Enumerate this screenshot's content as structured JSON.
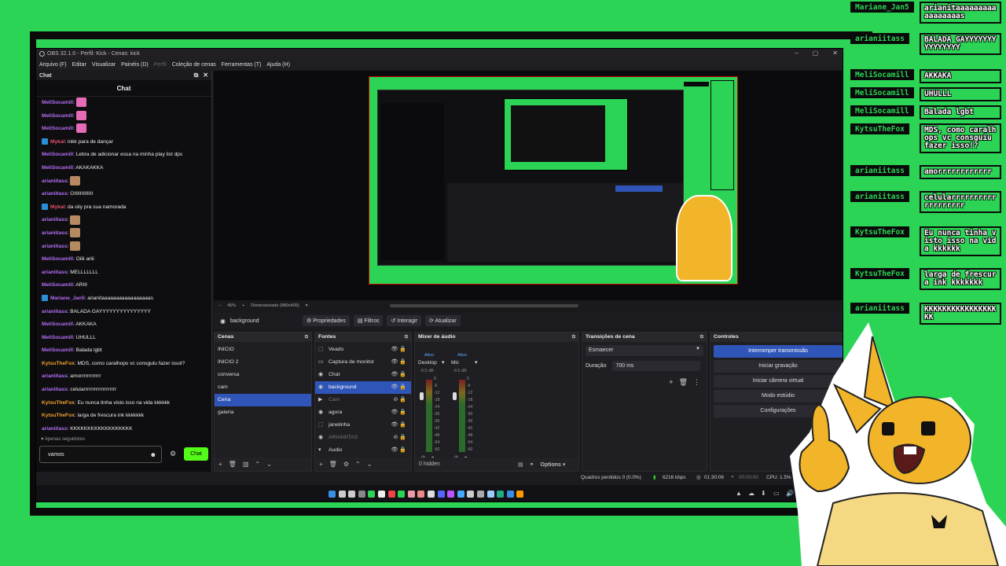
{
  "window": {
    "title": "OBS 32.1.0 - Perfil: Kick - Cenas: kick",
    "menu": [
      "Arquivo (F)",
      "Editar",
      "Visualizar",
      "Painéis (D)",
      "Perfil",
      "Coleção de cenas",
      "Ferramentas (T)",
      "Ajuda (H)"
    ]
  },
  "chat_dock": {
    "dock_title": "Chat",
    "header": "Chat",
    "messages": [
      {
        "user": "MeliSocamill",
        "sep": ": ",
        "text": "",
        "emote": "pink",
        "color": "#b46cf5"
      },
      {
        "user": "MeliSocamill",
        "sep": ": ",
        "text": "",
        "emote": "pink",
        "color": "#b46cf5"
      },
      {
        "user": "MeliSocamill",
        "sep": ": ",
        "text": "",
        "emote": "pink",
        "color": "#b46cf5"
      },
      {
        "user": "Mykal",
        "sep": ": ",
        "text": "inkk para de dançar",
        "emote": "",
        "color": "#e8506b",
        "badge": true
      },
      {
        "user": "MeliSocamill",
        "sep": ": ",
        "text": "Lebra de adicionar essa na minha play list dps",
        "emote": "",
        "color": "#b46cf5"
      },
      {
        "user": "MeliSocamill",
        "sep": ": ",
        "text": "AKAKAKKA",
        "emote": "",
        "color": "#b46cf5"
      },
      {
        "user": "arianiitass",
        "sep": ": ",
        "text": "",
        "emote": "cat",
        "color": "#b46cf5"
      },
      {
        "user": "arianiitass",
        "sep": ": ",
        "text": "OIIIIIIIIIIIII",
        "emote": "",
        "color": "#b46cf5"
      },
      {
        "user": "Mykal",
        "sep": ": ",
        "text": "da oiiy pra sua namorada",
        "emote": "",
        "color": "#e8506b",
        "badge": true
      },
      {
        "user": "arianiitass",
        "sep": ": ",
        "text": "",
        "emote": "cat",
        "color": "#b46cf5"
      },
      {
        "user": "arianiitass",
        "sep": ": ",
        "text": "",
        "emote": "cat",
        "color": "#b46cf5"
      },
      {
        "user": "arianiitass",
        "sep": ": ",
        "text": "",
        "emote": "cat",
        "color": "#b46cf5"
      },
      {
        "user": "MeliSocamill",
        "sep": ": ",
        "text": "Oiiii ariii",
        "emote": "",
        "color": "#b46cf5"
      },
      {
        "user": "arianiitass",
        "sep": ": ",
        "text": "MELLLLLLL",
        "emote": "",
        "color": "#b46cf5"
      },
      {
        "user": "MeliSocamill",
        "sep": ": ",
        "text": "ARIII",
        "emote": "",
        "color": "#b46cf5"
      },
      {
        "user": "Mariane_Jan5",
        "sep": ": ",
        "text": "arianitaaaaaaaaaaaaaaaaas",
        "emote": "",
        "color": "#b46cf5",
        "badge": true
      },
      {
        "user": "arianiitass",
        "sep": ": ",
        "text": "BALADA GAYYYYYYYYYYYYYYY",
        "emote": "",
        "color": "#b46cf5"
      },
      {
        "user": "MeliSocamill",
        "sep": ": ",
        "text": "AKKAKA",
        "emote": "",
        "color": "#b46cf5"
      },
      {
        "user": "MeliSocamill",
        "sep": ": ",
        "text": "UHULLL",
        "emote": "",
        "color": "#b46cf5"
      },
      {
        "user": "MeliSocamill",
        "sep": ": ",
        "text": "Balada lgbt",
        "emote": "",
        "color": "#b46cf5"
      },
      {
        "user": "KytsuTheFox",
        "sep": ": ",
        "text": "MDS, como caralhops vc consgulu fazer issol?",
        "emote": "",
        "color": "#f0a030"
      },
      {
        "user": "arianiitass",
        "sep": ": ",
        "text": "amorrrrrrrrrrrr",
        "emote": "",
        "color": "#b46cf5"
      },
      {
        "user": "arianiitass",
        "sep": ": ",
        "text": "celularrrrrrrrrrrrrrrrrrr",
        "emote": "",
        "color": "#b46cf5"
      },
      {
        "user": "KytsuTheFox",
        "sep": ": ",
        "text": "Eu nunca tinha visto isso na vida kkkkkk",
        "emote": "",
        "color": "#f0a030"
      },
      {
        "user": "KytsuTheFox",
        "sep": ": ",
        "text": "larga de frescura ink kkkkkkk",
        "emote": "",
        "color": "#f0a030"
      },
      {
        "user": "arianiitass",
        "sep": ": ",
        "text": "KKKKKKKKKKKKKKKKKK",
        "emote": "",
        "color": "#b46cf5"
      }
    ],
    "followers_label": "♥ Apenas seguidores",
    "input_value": "vamos",
    "send_label": "Chat"
  },
  "preview_bar": {
    "zoom": "45%",
    "dims": "Dimensionado (880x405)"
  },
  "source_toolbar": {
    "current": "background",
    "buttons": [
      "Propriedades",
      "Filtros",
      "Interagir",
      "Atualizar"
    ]
  },
  "scenes": {
    "title": "Cenas",
    "items": [
      "INICIO",
      "INICIO 2",
      "conversa",
      "cam",
      "Cena",
      "galeria"
    ],
    "selected": 4
  },
  "sources": {
    "title": "Fontes",
    "items": [
      {
        "name": "Veado",
        "icon": "⬚",
        "off": false
      },
      {
        "name": "Captura de monitor",
        "icon": "▭",
        "off": false
      },
      {
        "name": "Chat",
        "icon": "◉",
        "off": false
      },
      {
        "name": "background",
        "icon": "◉",
        "off": false,
        "sel": true
      },
      {
        "name": "Cam",
        "icon": "▶",
        "off": true
      },
      {
        "name": "agora",
        "icon": "◉",
        "off": false
      },
      {
        "name": "janelinha",
        "icon": "⬚",
        "off": false
      },
      {
        "name": "ARIANIITAS",
        "icon": "◉",
        "off": true
      },
      {
        "name": "Audio",
        "icon": "▾",
        "off": false
      }
    ]
  },
  "mixer": {
    "title": "Mixer de áudio",
    "channels": [
      {
        "name": "Desktop",
        "state": "Ativo",
        "db": "-9.5 dB"
      },
      {
        "name": "Mic",
        "state": "Ativo",
        "db": "-9.5 dB"
      }
    ],
    "scale": [
      "0",
      "-6",
      "-12",
      "-18",
      "-24",
      "-30",
      "-36",
      "-42",
      "-48",
      "-54",
      "-60"
    ],
    "hidden_label": "0 hidden",
    "options_label": "Options"
  },
  "transitions": {
    "title": "Transições de cena",
    "type": "Esmaecer",
    "duration_label": "Duração",
    "duration_value": "700 ms"
  },
  "controls": {
    "title": "Controles",
    "buttons": [
      "Interromper transmissão",
      "Iniciar gravação",
      "Iniciar câmera virtual",
      "Modo estúdio",
      "Configurações"
    ]
  },
  "status": {
    "frames": "Quadros perdidos 0 (0.0%)",
    "bitrate": "6216 kbps",
    "stream_time": "01:30:06",
    "rec_time": "00:00:00",
    "cpu": "CPU: 1.5%"
  },
  "overlay_chat": [
    {
      "user": "Mariane_Jan5",
      "text": "arianitaaaaaaaaaaaaaaaaas"
    },
    {
      "user": "arianiitass",
      "text": "BALADA GAYYYYYYYYYYYYYYY"
    },
    {
      "user": "MeliSocamill",
      "text": "AKKAKA"
    },
    {
      "user": "MeliSocamill",
      "text": "UHULLL"
    },
    {
      "user": "MeliSocamill",
      "text": "Balada lgbt"
    },
    {
      "user": "KytsuTheFox",
      "text": "MDS, como caralhops vc consguiu fazer isso!?"
    },
    {
      "user": "arianiitass",
      "text": "amorrrrrrrrrrrr"
    },
    {
      "user": "arianiitass",
      "text": "celularrrrrrrrrrrrrrrrrrr"
    },
    {
      "user": "KytsuTheFox",
      "text": "Eu nunca tinha visto isso na vida kkkkkk"
    },
    {
      "user": "KytsuTheFox",
      "text": "larga de frescura ink kkkkkkk"
    },
    {
      "user": "arianiitass",
      "text": "KKKKKKKKKKKKKKKKKK"
    }
  ],
  "colors": {
    "accent_green": "#2bd455",
    "kick_green": "#53fc18",
    "select_blue": "#2f55b8"
  }
}
